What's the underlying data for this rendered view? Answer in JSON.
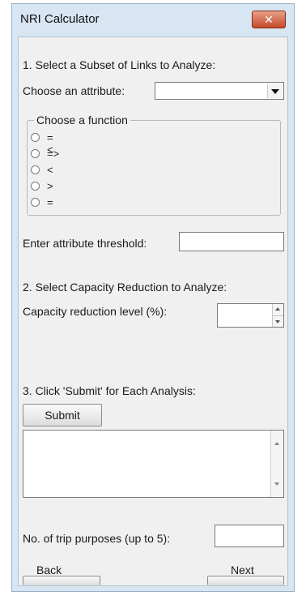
{
  "window": {
    "title": "NRI Calculator",
    "close_glyph": "✕"
  },
  "section1": {
    "heading": "1. Select a Subset of Links to Analyze:",
    "attribute_label": "Choose an attribute:",
    "attribute_value": ""
  },
  "function_group": {
    "legend": "Choose a function",
    "options": [
      "=<",
      "=>",
      "<",
      ">",
      "="
    ]
  },
  "threshold": {
    "label": "Enter attribute threshold:",
    "value": ""
  },
  "section2": {
    "heading": "2. Select Capacity Reduction to Analyze:",
    "capacity_label": "Capacity reduction level (%):",
    "capacity_value": ""
  },
  "section3": {
    "heading": "3. Click 'Submit' for Each Analysis:",
    "submit_label": "Submit",
    "results_text": ""
  },
  "trip": {
    "label": "No. of trip purposes (up to 5):",
    "value": ""
  },
  "nav": {
    "back_label": "Back",
    "next_label": "Next"
  },
  "colors": {
    "titlebar": "#d8e5f2",
    "close_button": "#c44a2a",
    "client_background": "#f0f0f0"
  },
  "icons": {
    "close": "close-icon",
    "dropdown": "chevron-down-icon",
    "spin": "spinner-arrows-icon",
    "scroll": "scroll-arrows-icon"
  }
}
